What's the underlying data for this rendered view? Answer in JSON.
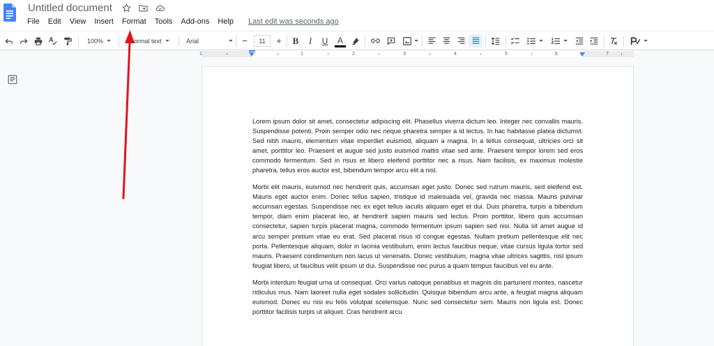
{
  "app": {
    "title": "Untitled document",
    "last_edit": "Last edit was seconds ago"
  },
  "menu": [
    "File",
    "Edit",
    "View",
    "Insert",
    "Format",
    "Tools",
    "Add-ons",
    "Help"
  ],
  "toolbar": {
    "zoom": "100%",
    "style": "Normal text",
    "font": "Arial",
    "font_size": "11",
    "minus": "−",
    "plus": "+",
    "bold": "B",
    "italic": "I",
    "underline": "U",
    "text_color_glyph": "A"
  },
  "ruler": {
    "numbers": [
      "1",
      "1",
      "2",
      "3",
      "4",
      "5",
      "6",
      "7"
    ]
  },
  "document": {
    "paragraphs": [
      "Lorem ipsum dolor sit amet, consectetur adipiscing elit. Phasellus viverra dictum leo. Integer nec convallis mauris. Suspendisse potenti. Proin semper odio nec neque pharetra semper a id lectus. In hac habitasse platea dictumst. Sed nibh mauris, elementum vitae imperdiet euismod, aliquam a magna. In a tellus consequat, ultricies orci sit amet, porttitor leo. Praesent et augue sed justo euismod mattis vitae sed ante. Praesent tempor lorem sed eros commodo fermentum. Sed in risus et libero eleifend porttitor nec a risus. Nam facilisis, ex maximus molestie pharetra, tellus eros auctor est, bibendum tempor arcu elit a nisl.",
      "Morbi elit mauris, euismod nec hendrerit quis, accumsan eget justo. Donec sed rutrum mauris, sed eleifend est. Mauris eget auctor enim. Donec tellus sapien, tristique id malesuada vel, gravida nec massa. Mauris pulvinar accumsan egestas. Suspendisse nec ex eget tellus iaculis aliquam eget et dui. Duis pharetra, turpis a bibendum tempor, diam enim placerat leo, at hendrerit sapien mauris sed lectus. Proin porttitor, libero quis accumsan consectetur, sapien turpis placerat magna, commodo fermentum ipsum sapien sed nisi. Nulla sit amet augue id arcu semper pretium vitae eu erat. Sed placerat risus id congue egestas. Nullam pretium pellentesque elit nec porta. Pellentesque aliquam, dolor in lacinia vestibulum, enim lectus faucibus neque, vitae cursus ligula tortor sed mauris. Praesent condimentum non lacus ut venenatis. Donec vestibulum, magna vitae ultrices sagittis, nisl ipsum feugiat libero, ut faucibus velit ipsum ut dui. Suspendisse nec purus a quam tempus faucibus vel eu ante.",
      "Morbi interdum feugiat urna ut consequat. Orci varius natoque penatibus et magnis dis parturient montes, nascetur ridiculus mus. Nam laoreet nulla eget sodales sollicitudin. Quisque bibendum arcu ante, a feugiat magna aliquam euismod. Donec eu nisi eu felis volutpat scelerisque. Nunc sed consectetur sem. Mauris non ligula est. Donec porttitor facilisis turpis ut aliquet. Cras hendrerit arcu"
    ]
  },
  "colors": {
    "brand_blue": "#4285f4",
    "annotation_arrow": "#e0141c",
    "text_color_underline": "#000000"
  },
  "icons": [
    "docs-logo",
    "star-icon",
    "move-folder-icon",
    "cloud-saved-icon",
    "undo-icon",
    "redo-icon",
    "print-icon",
    "spellcheck-icon",
    "paint-format-icon",
    "highlight-icon",
    "link-icon",
    "comment-icon",
    "image-icon",
    "align-left-icon",
    "align-center-icon",
    "align-right-icon",
    "align-justify-icon",
    "line-spacing-icon",
    "checklist-icon",
    "bulleted-list-icon",
    "numbered-list-icon",
    "decrease-indent-icon",
    "increase-indent-icon",
    "clear-formatting-icon",
    "editing-mode-icon",
    "outline-icon"
  ]
}
